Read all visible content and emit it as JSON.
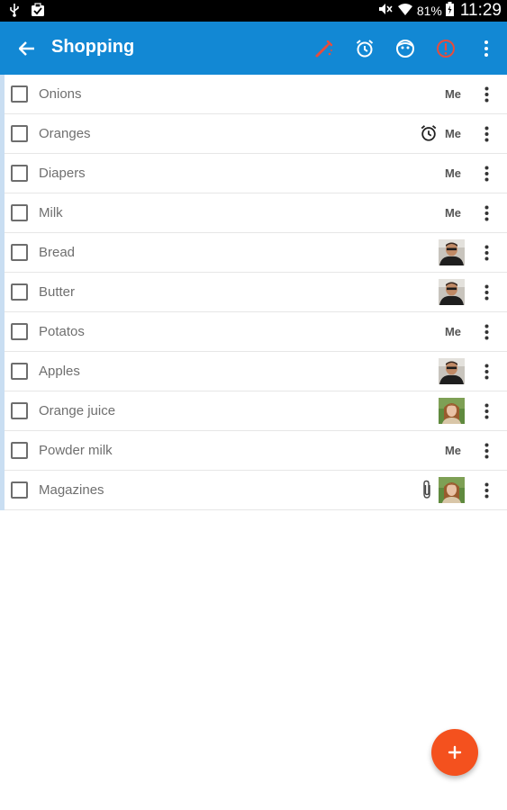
{
  "status_bar": {
    "battery_percent": "81%",
    "time": "11:29"
  },
  "app_bar": {
    "title": "Shopping",
    "actions": [
      "brush-icon",
      "alarm-icon",
      "face-icon",
      "info-icon",
      "more-vert-icon"
    ],
    "colors": {
      "background": "#1288d4",
      "brush": "#e74c3c",
      "info": "#e74c3c"
    }
  },
  "items": [
    {
      "label": "Onions",
      "assignee": "Me"
    },
    {
      "label": "Oranges",
      "assignee": "Me",
      "reminder": "alarm-icon"
    },
    {
      "label": "Diapers",
      "assignee": "Me"
    },
    {
      "label": "Milk",
      "assignee": "Me"
    },
    {
      "label": "Bread",
      "assignee": "avatar-man"
    },
    {
      "label": "Butter",
      "assignee": "avatar-man"
    },
    {
      "label": "Potatos",
      "assignee": "Me"
    },
    {
      "label": "Apples",
      "assignee": "avatar-man"
    },
    {
      "label": "Orange juice",
      "assignee": "avatar-woman"
    },
    {
      "label": "Powder milk",
      "assignee": "Me"
    },
    {
      "label": "Magazines",
      "assignee": "avatar-woman",
      "attachment": "paperclip-icon"
    }
  ],
  "fab": {
    "icon": "plus-icon",
    "color": "#f4511e"
  }
}
